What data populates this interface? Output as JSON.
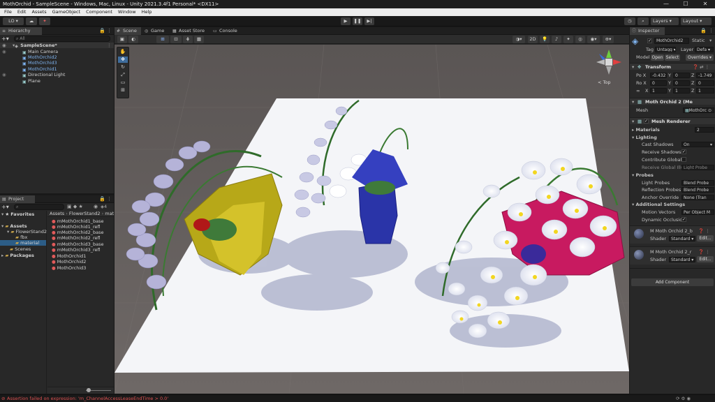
{
  "window": {
    "title": "MothOrchid - SampleScene - Windows, Mac, Linux - Unity 2021.3.4f1 Personal* <DX11>",
    "minimize": "—",
    "maximize": "☐",
    "close": "✕"
  },
  "menu": [
    "File",
    "Edit",
    "Assets",
    "GameObject",
    "Component",
    "Window",
    "Help"
  ],
  "toolbar": {
    "account": "LO ▾",
    "layers": "Layers",
    "layout": "Layout"
  },
  "hierarchy": {
    "tab": "Hierarchy",
    "search_placeholder": "All",
    "items": [
      {
        "label": "SampleScene*",
        "kind": "scene"
      },
      {
        "label": "Main Camera",
        "kind": "object"
      },
      {
        "label": "MothOrchid2",
        "kind": "prefab"
      },
      {
        "label": "MothOrchid3",
        "kind": "prefab"
      },
      {
        "label": "MothOrchid1",
        "kind": "prefab"
      },
      {
        "label": "Directional Light",
        "kind": "object"
      },
      {
        "label": "Plane",
        "kind": "object"
      }
    ]
  },
  "project": {
    "tab": "Project",
    "count": "4",
    "tree": [
      {
        "label": "Favorites"
      },
      {
        "label": "Assets"
      },
      {
        "label": "FlowerStand2"
      },
      {
        "label": "fbx"
      },
      {
        "label": "material"
      },
      {
        "label": "Scenes"
      },
      {
        "label": "Packages"
      }
    ],
    "breadcrumb": [
      "Assets",
      "FlowerStand2",
      "mat"
    ],
    "files": [
      "mMothOrchid1_base",
      "mMothOrchid1_refl",
      "mMothOrchid2_base",
      "mMothOrchid2_refl",
      "mMothOrchid3_base",
      "mMothOrchid3_refl",
      "MothOrchid1",
      "MothOrchid2",
      "MothOrchid3"
    ]
  },
  "scene": {
    "tabs": [
      "Scene",
      "Game",
      "Asset Store",
      "Console"
    ],
    "mode_2d": "2D",
    "gizmo_label": "< Top"
  },
  "inspector": {
    "tab": "Inspector",
    "object_name": "MothOrchid2",
    "static_label": "Static",
    "tag_label": "Tag",
    "tag_value": "Untagg",
    "layer_label": "Layer",
    "layer_value": "Defa",
    "model_label": "Model",
    "open_label": "Open",
    "select_label": "Select",
    "overrides_label": "Overrides",
    "transform": {
      "title": "Transform",
      "pos_label": "Po X",
      "pos": [
        "-0.432",
        "0",
        "-1.749"
      ],
      "rot_label": "Ro X",
      "rot": [
        "0",
        "0",
        "0"
      ],
      "scale_label": "X",
      "scale": [
        "1",
        "1",
        "1"
      ],
      "axis_y": "Y",
      "axis_z": "Z"
    },
    "mesh_filter": {
      "title": "Moth Orchid 2 (Me",
      "mesh_label": "Mesh",
      "mesh_value": "MothOrc"
    },
    "mesh_renderer": {
      "title": "Mesh Renderer",
      "materials_label": "Materials",
      "materials_count": "2",
      "lighting_label": "Lighting",
      "cast_shadows_label": "Cast Shadows",
      "cast_shadows_value": "On",
      "receive_shadows_label": "Receive Shadows",
      "contribute_gi_label": "Contribute Global I",
      "receive_gi_label": "Receive Global Illu",
      "receive_gi_value": "Light Probe",
      "probes_label": "Probes",
      "light_probes_label": "Light Probes",
      "light_probes_value": "Blend Probe",
      "reflection_probes_label": "Reflection Probes",
      "reflection_probes_value": "Blend Probe",
      "anchor_override_label": "Anchor Override",
      "anchor_override_value": "None (Tran",
      "additional_label": "Additional Settings",
      "motion_vectors_label": "Motion Vectors",
      "motion_vectors_value": "Per Object M",
      "dynamic_occlusion_label": "Dynamic Occlusion"
    },
    "materials": [
      {
        "name": "M Moth Orchid 2_b",
        "shader_label": "Shader",
        "shader": "Standard",
        "edit": "Edit..."
      },
      {
        "name": "M Moth Orchid 2_r",
        "shader_label": "Shader",
        "shader": "Standard",
        "edit": "Edit..."
      }
    ],
    "add_component": "Add Component"
  },
  "status": {
    "message": "Assertion failed on expression: 'm_ChannelAccessLeaseEndTime > 0.0'"
  },
  "colors": {
    "accent": "#2c5d87",
    "error": "#e05252",
    "floor": "#f4f5f8",
    "ground": "#6b6462"
  }
}
